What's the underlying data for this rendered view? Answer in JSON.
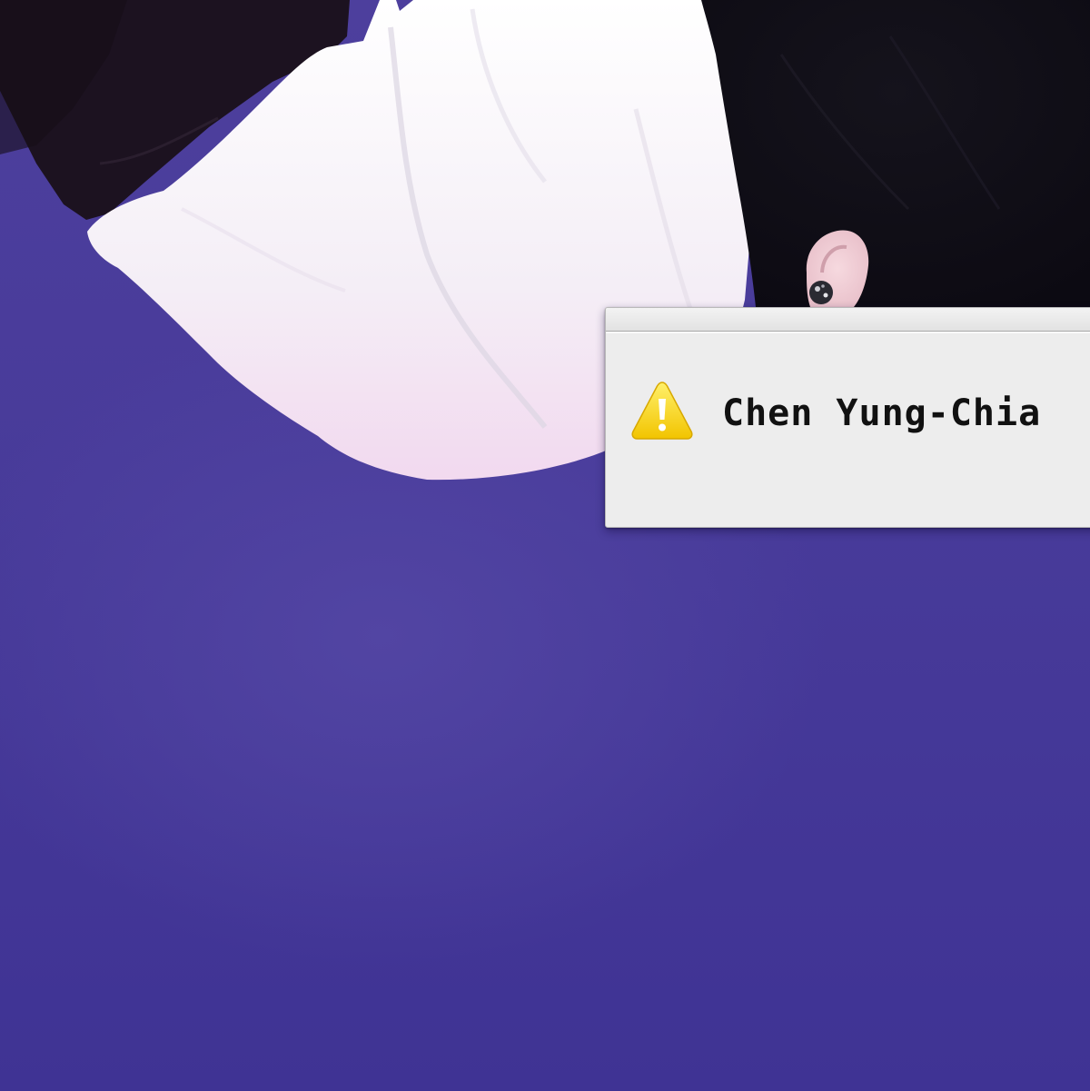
{
  "desktop": {
    "background_color": "#4a3c98"
  },
  "dialog": {
    "message": "Chen Yung-Chia",
    "icon": "warning-icon",
    "icon_color": "#f5d400",
    "background_color": "#ededed"
  }
}
